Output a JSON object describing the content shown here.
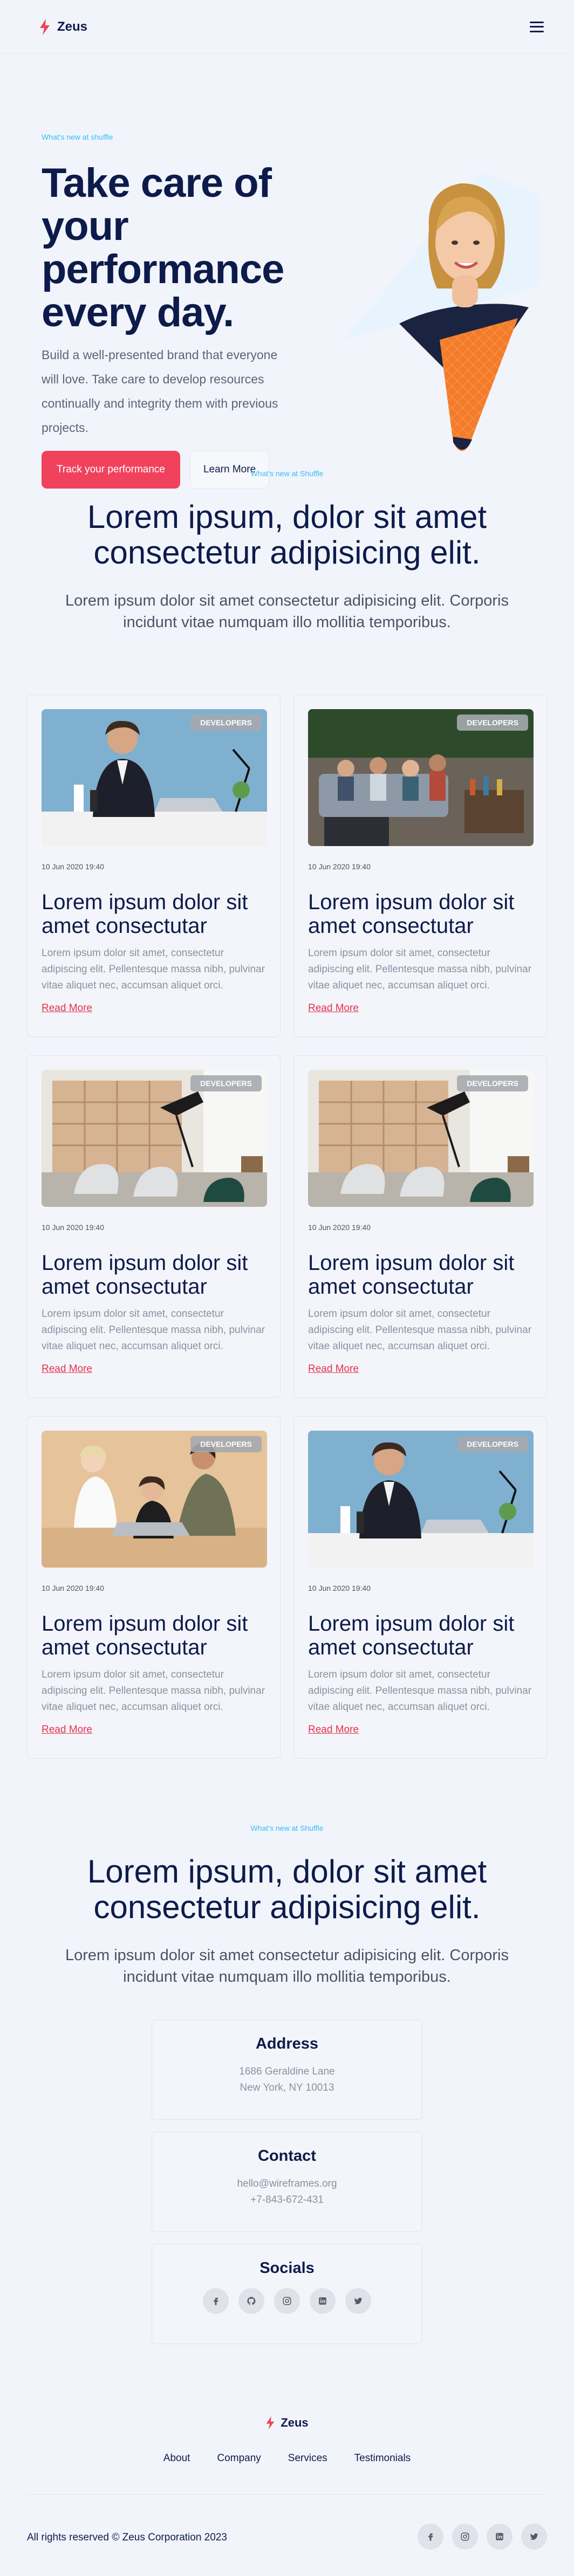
{
  "header": {
    "brand": "Zeus",
    "menu_icon": "hamburger-icon"
  },
  "hero": {
    "eyebrow": "What's new at shuffle",
    "title": "Take care of your performance every day.",
    "description": "Build a well-presented brand that everyone will love. Take care to develop resources continually and integrity them with previous projects.",
    "primary_cta": "Track your performance",
    "secondary_cta": "Learn More"
  },
  "blog_section": {
    "eyebrow": "What's new at Shuffle",
    "title": "Lorem ipsum, dolor sit amet consectetur adipisicing elit.",
    "description": "Lorem ipsum dolor sit amet consectetur adipisicing elit. Corporis incidunt vitae numquam illo mollitia temporibus."
  },
  "cards": [
    {
      "badge": "DEVELOPERS",
      "date": "10 Jun 2020 19:40",
      "title": "Lorem ipsum dolor sit amet consectutar",
      "excerpt": "Lorem ipsum dolor sit amet, consectetur adipiscing elit. Pellentesque massa nibh, pulvinar vitae aliquet nec, accumsan aliquet orci.",
      "link": "Read More",
      "image": "office-man-laptop"
    },
    {
      "badge": "DEVELOPERS",
      "date": "10 Jun 2020 19:40",
      "title": "Lorem ipsum dolor sit amet consectutar",
      "excerpt": "Lorem ipsum dolor sit amet, consectetur adipiscing elit. Pellentesque massa nibh, pulvinar vitae aliquet nec, accumsan aliquet orci.",
      "link": "Read More",
      "image": "people-lounge"
    },
    {
      "badge": "DEVELOPERS",
      "date": "10 Jun 2020 19:40",
      "title": "Lorem ipsum dolor sit amet consectutar",
      "excerpt": "Lorem ipsum dolor sit amet, consectetur adipiscing elit. Pellentesque massa nibh, pulvinar vitae aliquet nec, accumsan aliquet orci.",
      "link": "Read More",
      "image": "interior-chairs"
    },
    {
      "badge": "DEVELOPERS",
      "date": "10 Jun 2020 19:40",
      "title": "Lorem ipsum dolor sit amet consectutar",
      "excerpt": "Lorem ipsum dolor sit amet, consectetur adipiscing elit. Pellentesque massa nibh, pulvinar vitae aliquet nec, accumsan aliquet orci.",
      "link": "Read More",
      "image": "interior-chairs"
    },
    {
      "badge": "DEVELOPERS",
      "date": "10 Jun 2020 19:40",
      "title": "Lorem ipsum dolor sit amet consectutar",
      "excerpt": "Lorem ipsum dolor sit amet, consectetur adipiscing elit. Pellentesque massa nibh, pulvinar vitae aliquet nec, accumsan aliquet orci.",
      "link": "Read More",
      "image": "team-laptop"
    },
    {
      "badge": "DEVELOPERS",
      "date": "10 Jun 2020 19:40",
      "title": "Lorem ipsum dolor sit amet consectutar",
      "excerpt": "Lorem ipsum dolor sit amet, consectetur adipiscing elit. Pellentesque massa nibh, pulvinar vitae aliquet nec, accumsan aliquet orci.",
      "link": "Read More",
      "image": "office-man-laptop"
    }
  ],
  "contact_section": {
    "eyebrow": "What's new at Shuffle",
    "title": "Lorem ipsum, dolor sit amet consectetur adipisicing elit.",
    "description": "Lorem ipsum dolor sit amet consectetur adipisicing elit. Corporis incidunt vitae numquam illo mollitia temporibus."
  },
  "address": {
    "title": "Address",
    "line1": "1686 Geraldine Lane",
    "line2": "New York, NY 10013"
  },
  "contact": {
    "title": "Contact",
    "email": "hello@wireframes.org",
    "phone": "+7-843-672-431"
  },
  "socials": {
    "title": "Socials",
    "icons": [
      "facebook-icon",
      "github-icon",
      "instagram-icon",
      "linkedin-icon",
      "twitter-icon"
    ]
  },
  "footer": {
    "brand": "Zeus",
    "nav": [
      "About",
      "Company",
      "Services",
      "Testimonials"
    ],
    "copyright": "All rights reserved © Zeus Corporation 2023",
    "social_icons": [
      "facebook-icon",
      "instagram-icon",
      "linkedin-icon",
      "twitter-icon"
    ]
  },
  "colors": {
    "primary": "#f0425d",
    "navy": "#0d1b4b",
    "accent": "#38bdf8",
    "background": "#f1f4fa"
  }
}
